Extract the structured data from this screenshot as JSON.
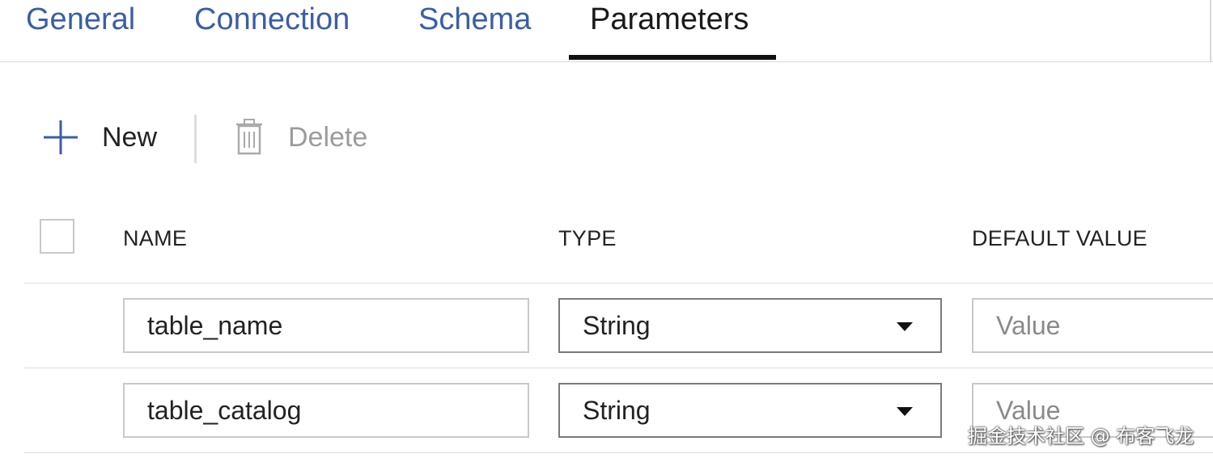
{
  "tabs": [
    {
      "label": "General",
      "active": false
    },
    {
      "label": "Connection",
      "active": false
    },
    {
      "label": "Schema",
      "active": false
    },
    {
      "label": "Parameters",
      "active": true
    }
  ],
  "toolbar": {
    "new_label": "New",
    "new_icon": "plus-icon",
    "delete_label": "Delete",
    "delete_icon": "trash-icon"
  },
  "table": {
    "columns": [
      "NAME",
      "TYPE",
      "DEFAULT VALUE"
    ],
    "rows": [
      {
        "name": "table_name",
        "type": "String",
        "default_placeholder": "Value"
      },
      {
        "name": "table_catalog",
        "type": "String",
        "default_placeholder": "Value"
      }
    ]
  },
  "watermark": "掘金技术社区 @ 布客飞龙",
  "colors": {
    "tab_link": "#3a5ea8",
    "accent_icon": "#3a5ea8",
    "active_underline": "#111111",
    "disabled_text": "#9b9b9b"
  }
}
